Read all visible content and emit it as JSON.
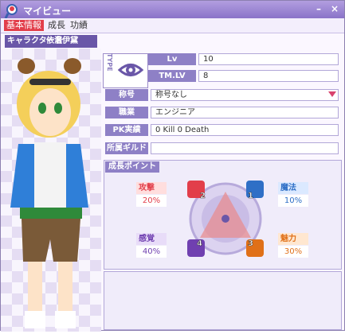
{
  "window": {
    "title": "マイビュー",
    "min_symbol": "–",
    "close_symbol": "×"
  },
  "tabs": [
    {
      "label": "基本情報",
      "active": true
    },
    {
      "label": "成長",
      "active": false
    },
    {
      "label": "功績",
      "active": false
    }
  ],
  "character": {
    "name_label": "キャラクター名",
    "name": "依澄伊黛"
  },
  "type_label": "TYPE",
  "info": {
    "lv_label": "Lv",
    "lv": "10",
    "tmlv_label": "TM.LV",
    "tmlv": "8",
    "title_label": "称号",
    "title_value": "称号なし",
    "job_label": "職業",
    "job": "エンジニア",
    "pk_label": "PK実績",
    "pk": "0 Kill  0 Death",
    "guild_label": "所属ギルド",
    "guild": ""
  },
  "growth": {
    "title": "成長ポイント",
    "stats": [
      {
        "label": "攻撃",
        "value": "20%",
        "color": "#e23e4a",
        "bg": "#ffdede"
      },
      {
        "label": "魔法",
        "value": "10%",
        "color": "#2f6fc6",
        "bg": "#dbe9ff"
      },
      {
        "label": "感覚",
        "value": "40%",
        "color": "#7040b0",
        "bg": "#e8dcf8"
      },
      {
        "label": "魅力",
        "value": "30%",
        "color": "#e07018",
        "bg": "#ffe7d0"
      }
    ],
    "badges": [
      "2",
      "1",
      "4",
      "3"
    ]
  },
  "colors": {
    "accent": "#8e80c6",
    "titlebar": "#8a73c8",
    "active_tab": "#e23e4a"
  }
}
